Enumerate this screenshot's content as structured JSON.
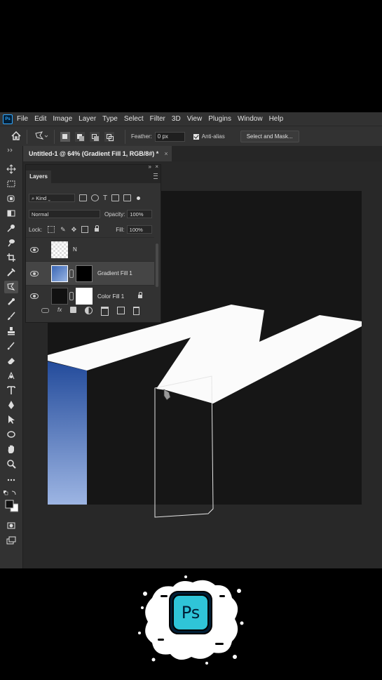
{
  "menubar": {
    "items": [
      "File",
      "Edit",
      "Image",
      "Layer",
      "Type",
      "Select",
      "Filter",
      "3D",
      "View",
      "Plugins",
      "Window",
      "Help"
    ]
  },
  "options": {
    "feather_label": "Feather:",
    "feather_value": "0 px",
    "antialias_label": "Anti-alias",
    "antialias_checked": true,
    "select_mask_label": "Select and Mask..."
  },
  "document": {
    "tab_title": "Untitled-1 @ 64% (Gradient Fill 1, RGB/8#) *",
    "close_glyph": "×"
  },
  "layers_panel": {
    "title": "Layers",
    "kind_label": "Kind",
    "blend_mode": "Normal",
    "opacity_label": "Opacity:",
    "opacity_value": "100%",
    "lock_label": "Lock:",
    "fill_label": "Fill:",
    "fill_value": "100%",
    "layers": [
      {
        "name": "N",
        "visible": true,
        "selected": false
      },
      {
        "name": "Gradient Fill 1",
        "visible": true,
        "selected": true
      },
      {
        "name": "Color Fill 1",
        "visible": true,
        "selected": false,
        "locked": true
      }
    ]
  },
  "brand": {
    "logo_text": "Ps"
  },
  "colors": {
    "canvas": "#161616",
    "panel": "#323232",
    "gradient_top": "#234b9b",
    "gradient_bottom": "#9db5e3",
    "accent": "#31a8ff"
  }
}
